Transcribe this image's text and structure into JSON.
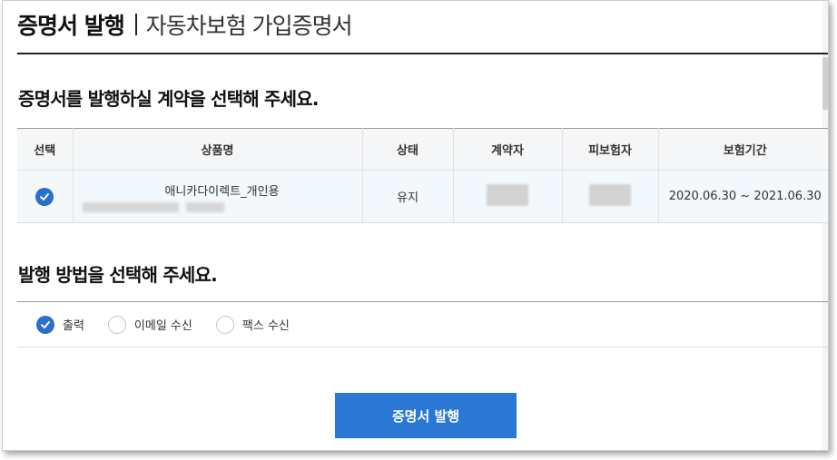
{
  "header": {
    "title": "증명서 발행",
    "subtitle": "자동차보험 가입증명서"
  },
  "contracts_section": {
    "title": "증명서를 발행하실 계약을 선택해 주세요.",
    "columns": [
      "선택",
      "상품명",
      "상태",
      "계약자",
      "피보험자",
      "보험기간"
    ],
    "rows": [
      {
        "selected": true,
        "product": "애니카다이렉트_개인용",
        "status": "유지",
        "period": "2020.06.30 ~ 2021.06.30"
      }
    ]
  },
  "method_section": {
    "title": "발행 방법을 선택해 주세요.",
    "options": [
      {
        "label": "출력",
        "selected": true
      },
      {
        "label": "이메일 수신",
        "selected": false
      },
      {
        "label": "팩스 수신",
        "selected": false
      }
    ]
  },
  "actions": {
    "issue_label": "증명서 발행"
  },
  "colors": {
    "accent": "#2a78d4",
    "selected_row_bg": "#f3f8fd",
    "header_bg": "#f5f6f7"
  }
}
